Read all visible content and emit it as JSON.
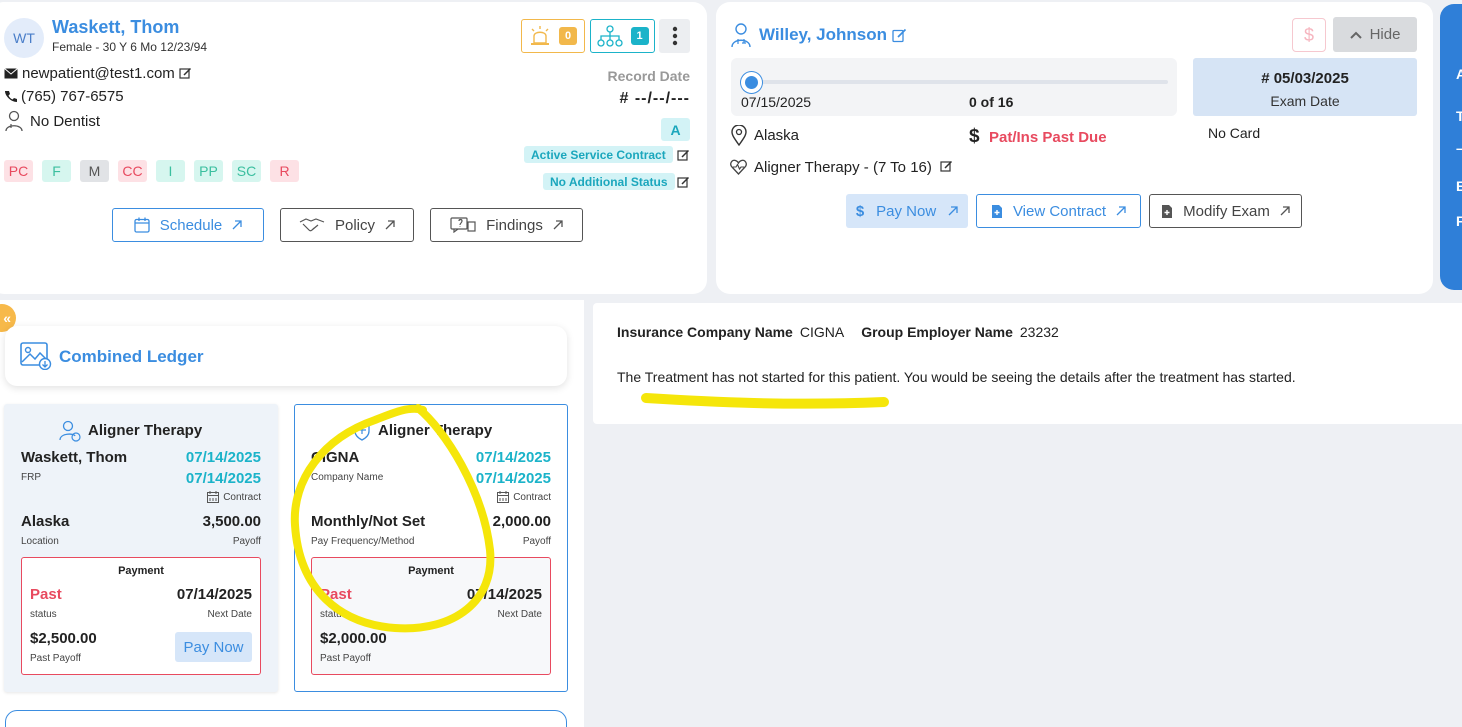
{
  "patient": {
    "initials": "WT",
    "name": "Waskett, Thom",
    "demographics": "Female - 30 Y 6 Mo 12/23/94",
    "email": "newpatient@test1.com",
    "phone": "(765) 767-6575",
    "dentist": "No Dentist",
    "alert_count": "0",
    "family_count": "1",
    "record_date_label": "Record Date",
    "record_date_value": "# --/--/---",
    "status_letter": "A",
    "contract_status": "Active Service Contract",
    "additional_status": "No Additional Status",
    "tags": [
      "PC",
      "F",
      "M",
      "CC",
      "I",
      "PP",
      "SC",
      "R"
    ],
    "buttons": {
      "schedule": "Schedule",
      "policy": "Policy",
      "findings": "Findings"
    }
  },
  "doctor": {
    "name": "Willey, Johnson",
    "hide_label": "Hide",
    "dollar_label": "$",
    "progress": {
      "start_date": "07/15/2025",
      "count": "0 of 16",
      "fraction": 0
    },
    "exam": {
      "date": "# 05/03/2025",
      "label": "Exam Date"
    },
    "location": "Alaska",
    "past_due": "Pat/Ins Past Due",
    "card": "No Card",
    "therapy": "Aligner Therapy - (7 To 16)",
    "buttons": {
      "pay_now": "Pay Now",
      "view_contract": "View Contract",
      "modify_exam": "Modify Exam"
    }
  },
  "ledger": {
    "title": "Combined Ledger",
    "collapse_icon": "«",
    "patient_card": {
      "title": "Aligner Therapy",
      "name": "Waskett, Thom",
      "role": "FRP",
      "date1": "07/14/2025",
      "date2": "07/14/2025",
      "contract_label": "Contract",
      "location": "Alaska",
      "location_label": "Location",
      "amount": "3,500.00",
      "amount_label": "Payoff",
      "payment": {
        "title": "Payment",
        "status": "Past",
        "status_label": "status",
        "next_date": "07/14/2025",
        "next_date_label": "Next Date",
        "past_payoff": "$2,500.00",
        "past_payoff_label": "Past Payoff",
        "pay_now": "Pay Now"
      }
    },
    "insurance_card": {
      "title": "Aligner Therapy",
      "name": "CIGNA",
      "role": "Company Name",
      "date1": "07/14/2025",
      "date2": "07/14/2025",
      "contract_label": "Contract",
      "frequency": "Monthly/Not Set",
      "frequency_label": "Pay Frequency/Method",
      "amount": "2,000.00",
      "amount_label": "Payoff",
      "payment": {
        "title": "Payment",
        "status": "Past",
        "status_label": "status",
        "next_date": "07/14/2025",
        "next_date_label": "Next Date",
        "past_payoff": "$2,000.00",
        "past_payoff_label": "Past Payoff"
      }
    }
  },
  "insurance": {
    "company_label": "Insurance Company Name",
    "company_value": "CIGNA",
    "employer_label": "Group Employer Name",
    "employer_value": "23232",
    "message": "The Treatment has not started for this patient. You would be seeing the details after the treatment has started."
  },
  "right_panel": {
    "letters": [
      "A",
      "T",
      "–",
      "E",
      "F"
    ]
  },
  "colors": {
    "accent": "#3b8de0",
    "teal": "#1bb3c9",
    "alert": "#e84a5f",
    "highlight": "#f5e60a"
  }
}
